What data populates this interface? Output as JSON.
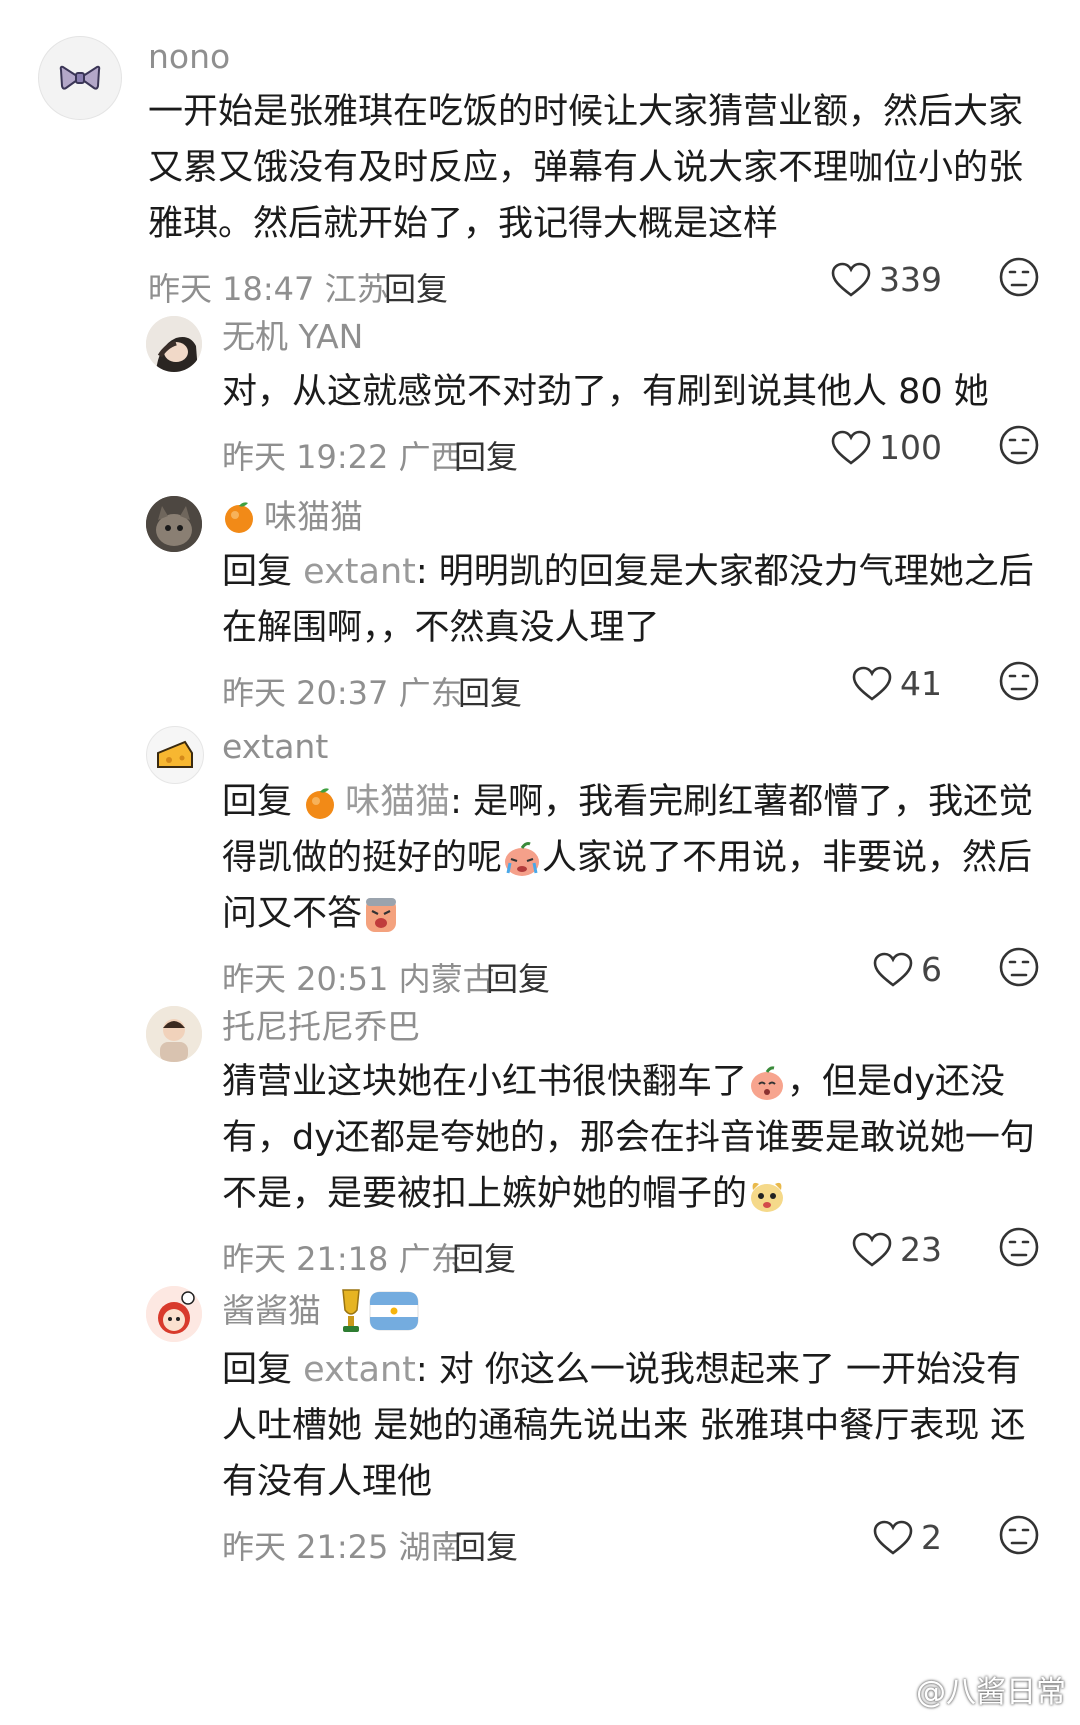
{
  "comments": [
    {
      "name": "nono",
      "text": "一开始是张雅琪在吃饭的时候让大家猜营业额，然后大家又累又饿没有及时反应，弹幕有人说大家不理咖位小的张雅琪。然后就开始了，我记得大概是这样",
      "time": "昨天 18:47 江苏",
      "reply_label": "回复",
      "likes": "339"
    },
    {
      "name": "无机 YAN",
      "text": "对，从这就感觉不对劲了，有刷到说其他人 80 她",
      "time": "昨天 19:22 广西",
      "reply_label": "回复",
      "likes": "100"
    },
    {
      "name": "味猫猫",
      "reply_prefix": "回复",
      "mention": "extant",
      "text": ": 明明凯的回复是大家都没力气理她之后在解围啊，，不然真没人理了",
      "time": "昨天 20:37 广东",
      "reply_label": "回复",
      "likes": "41"
    },
    {
      "name": "extant",
      "reply_prefix": "回复",
      "mention": "味猫猫",
      "text_a": ": 是啊，我看完刷红薯都懵了，我还觉得凯做的挺好的呢",
      "text_b": "人家说了不用说，非要说，然后问又不答",
      "time": "昨天 20:51 内蒙古",
      "reply_label": "回复",
      "likes": "6"
    },
    {
      "name": "托尼托尼乔巴",
      "text_a": "猜营业这块她在小红书很快翻车了",
      "text_b": "，但是dy还没有，dy还都是夸她的，那会在抖音谁要是敢说她一句不是，是要被扣上嫉妒她的帽子的",
      "time": "昨天 21:18 广东",
      "reply_label": "回复",
      "likes": "23"
    },
    {
      "name": "酱酱猫",
      "reply_prefix": "回复",
      "mention": "extant",
      "text": ": 对 你这么一说我想起来了 一开始没有人吐槽她 是她的通稿先说出来 张雅琪中餐厅表现 还有没有人理他",
      "time": "昨天 21:25 湖南",
      "reply_label": "回复",
      "likes": "2"
    }
  ],
  "watermark": "@八酱日常",
  "icons": [
    "bow-avatar-icon",
    "heart-icon",
    "dislike-face-icon",
    "orange-emoji-icon",
    "crying-emoji-icon",
    "angry-emoji-icon",
    "peach-emoji-icon",
    "puppy-emoji-icon",
    "trophy-icon",
    "argentina-flag-icon"
  ]
}
